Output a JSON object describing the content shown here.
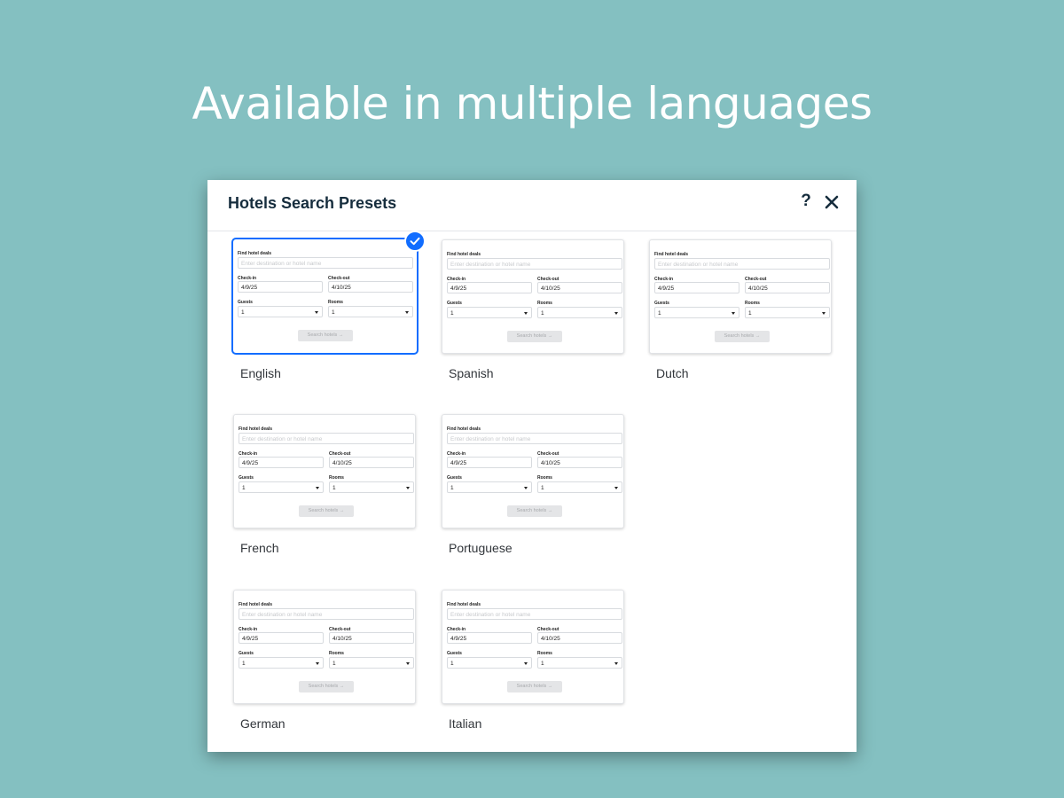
{
  "headline": "Available in multiple languages",
  "modal": {
    "title": "Hotels Search Presets",
    "help_label": "?"
  },
  "widget": {
    "find_label": "Find hotel deals",
    "destination_placeholder": "Enter destination or hotel name",
    "checkin_label": "Check-in",
    "checkin_value": "4/9/25",
    "checkout_label": "Check-out",
    "checkout_value": "4/10/25",
    "guests_label": "Guests",
    "guests_value": "1",
    "rooms_label": "Rooms",
    "rooms_value": "1",
    "search_button": "Search hotels →"
  },
  "presets": [
    {
      "label": "English",
      "selected": true
    },
    {
      "label": "Spanish",
      "selected": false
    },
    {
      "label": "Dutch",
      "selected": false
    },
    {
      "label": "French",
      "selected": false
    },
    {
      "label": "Portuguese",
      "selected": false
    },
    {
      "label": "German",
      "selected": false
    },
    {
      "label": "Italian",
      "selected": false
    }
  ],
  "colors": {
    "background": "#84c0c1",
    "accent": "#116dff"
  },
  "icons": {
    "close": "close-icon",
    "help": "help-icon",
    "selected": "checkmark-icon",
    "dropdown": "chevron-down-icon"
  }
}
